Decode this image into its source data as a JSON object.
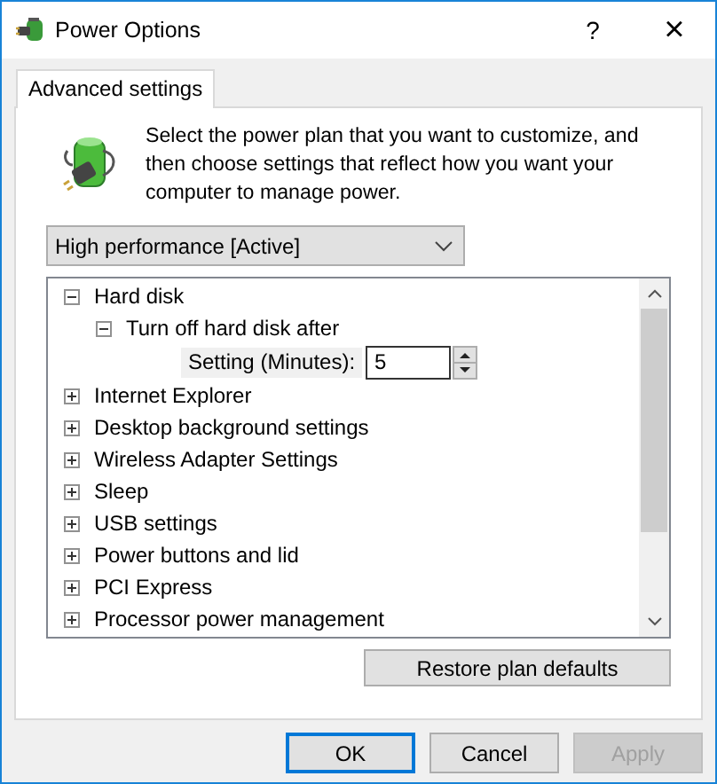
{
  "window": {
    "title": "Power Options",
    "help": "?",
    "close": "×"
  },
  "tabs": [
    {
      "label": "Advanced settings",
      "selected": true
    }
  ],
  "description": "Select the power plan that you want to customize, and then choose settings that reflect how you want your computer to manage power.",
  "plan_dropdown": {
    "value": "High performance [Active]"
  },
  "tree": [
    {
      "label": "Hard disk",
      "expanded": true,
      "children": [
        {
          "label": "Turn off hard disk after",
          "expanded": true,
          "setting": {
            "label": "Setting (Minutes):",
            "value": "5"
          }
        }
      ]
    },
    {
      "label": "Internet Explorer",
      "expanded": false
    },
    {
      "label": "Desktop background settings",
      "expanded": false
    },
    {
      "label": "Wireless Adapter Settings",
      "expanded": false
    },
    {
      "label": "Sleep",
      "expanded": false
    },
    {
      "label": "USB settings",
      "expanded": false
    },
    {
      "label": "Power buttons and lid",
      "expanded": false
    },
    {
      "label": "PCI Express",
      "expanded": false
    },
    {
      "label": "Processor power management",
      "expanded": false
    }
  ],
  "restore_button": "Restore plan defaults",
  "buttons": [
    {
      "label": "OK",
      "default": true,
      "disabled": false
    },
    {
      "label": "Cancel",
      "default": false,
      "disabled": false
    },
    {
      "label": "Apply",
      "default": false,
      "disabled": true
    }
  ]
}
